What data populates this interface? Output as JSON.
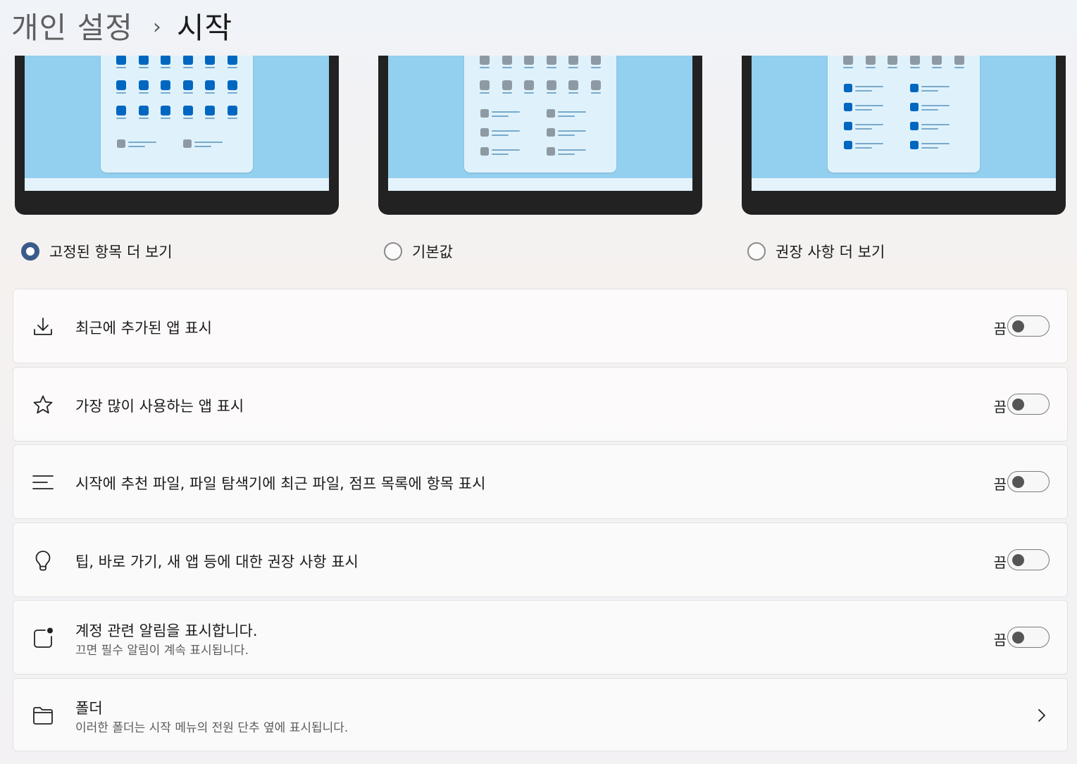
{
  "breadcrumb": {
    "parent": "개인 설정",
    "separator": "›",
    "current": "시작"
  },
  "layout_options": [
    {
      "label": "고정된 항목 더 보기",
      "selected": true
    },
    {
      "label": "기본값",
      "selected": false
    },
    {
      "label": "권장 사항 더 보기",
      "selected": false
    }
  ],
  "settings": [
    {
      "icon": "download-icon",
      "title": "최근에 추가된 앱 표시",
      "state": "끔",
      "on": false
    },
    {
      "icon": "star-icon",
      "title": "가장 많이 사용하는 앱 표시",
      "state": "끔",
      "on": false
    },
    {
      "icon": "list-icon",
      "title": "시작에 추천 파일, 파일 탐색기에 최근 파일, 점프 목록에 항목 표시",
      "state": "끔",
      "on": false
    },
    {
      "icon": "lightbulb-icon",
      "title": "팁, 바로 가기, 새 앱 등에 대한 권장 사항 표시",
      "state": "끔",
      "on": false
    },
    {
      "icon": "account-notification-icon",
      "title": "계정 관련 알림을 표시합니다.",
      "subtitle": "끄면 필수 알림이 계속 표시됩니다.",
      "state": "끔",
      "on": false
    },
    {
      "icon": "folder-icon",
      "title": "폴더",
      "subtitle": "이러한 폴더는 시작 메뉴의 전원 단추 옆에 표시됩니다."
    }
  ],
  "colors": {
    "accent": "#0067c0",
    "radio_selected": "#3b5c8a",
    "desktop_blue": "#93cfee",
    "icon_grey": "#8e9aa3"
  }
}
